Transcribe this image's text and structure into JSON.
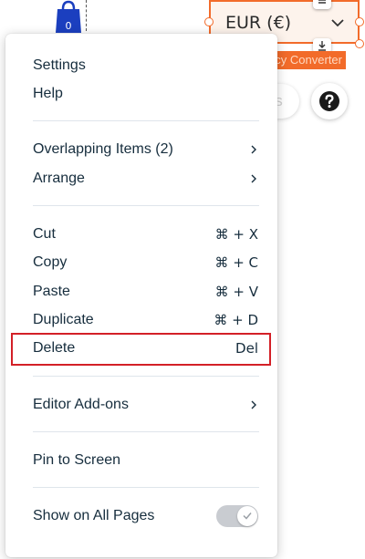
{
  "canvas": {
    "cart_count": "0",
    "currency_value": "EUR (€)",
    "converter_label": "Currency Converter",
    "settings_button": "Settings",
    "help_icon": "question-icon"
  },
  "menu": {
    "group1": [
      {
        "label": "Settings"
      },
      {
        "label": "Help"
      }
    ],
    "group2": [
      {
        "label": "Overlapping Items (2)",
        "icon": "chevron-right-icon"
      },
      {
        "label": "Arrange",
        "icon": "chevron-right-icon"
      }
    ],
    "group3": [
      {
        "label": "Cut",
        "shortcut": "⌘ + X"
      },
      {
        "label": "Copy",
        "shortcut": "⌘ + C"
      },
      {
        "label": "Paste",
        "shortcut": "⌘ + V"
      },
      {
        "label": "Duplicate",
        "shortcut": "⌘ + D"
      },
      {
        "label": "Delete",
        "shortcut": "Del"
      }
    ],
    "group4": [
      {
        "label": "Editor Add-ons",
        "icon": "chevron-right-icon"
      }
    ],
    "group5": [
      {
        "label": "Pin to Screen"
      }
    ],
    "group6": [
      {
        "label": "Show on All Pages",
        "toggle_on": true
      }
    ]
  },
  "colors": {
    "accent": "#f26b2a",
    "highlight": "#d32027",
    "text": "#162d3d"
  }
}
